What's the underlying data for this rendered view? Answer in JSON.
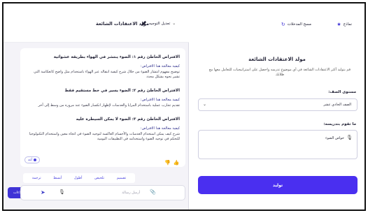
{
  "chat": {
    "header": {
      "title": "مولد الاعتقادات الشائعة",
      "edit_label": "تعديل التوجيه"
    },
    "message": {
      "blocks": [
        {
          "heading": "الافتراض الخاطئ رقم ١: الضوء ينتشر في الهواء بطريقة عشوائية",
          "question": "كيفية معالجة هذا الافتراض:",
          "answer": "توضيح مفهوم انتشار الضوء من خلال شرح كيفية انتقاله عبر الهواء باستخدام مثل واضح كانعكاسة التي تشير نحوه بشكل محدد"
        },
        {
          "heading": "الافتراض الخاطئ رقم ٢: الضوء يسير في خط مستقيم فقط",
          "question": "كيفية معالجة هذا الافتراض:",
          "answer": "تقديم تجارب عملية باستخدام المرايا والعدسات لإظهار انكسار الضوء عند مروره من وسط إلى آخر"
        },
        {
          "heading": "الافتراض الخاطئ رقم ٣: الضوء لا يمكن السيطرة عليه",
          "question": "كيفية معالجة هذا الافتراض:",
          "answer": "شرح كيف يمكن استخدام العدسات والأجسام العاكسة لتوجيه الضوء في اتجاه معين واستخدام التكنولوجيا للتحكم في توجيه الضوء واستخدامه في التطبيقات اليومية"
        }
      ]
    },
    "generate_chip": "أعد",
    "chips": [
      "تصميم",
      "تلخيص",
      "أطول",
      "أبسط",
      "ترجمة"
    ],
    "input_placeholder": "أرسل رسالة",
    "actions_label": "الإجراءات"
  },
  "tool": {
    "models_label": "نماذج",
    "clear_label": "مسح المدخلات",
    "title": "مولد الاعتقادات الشائعة",
    "description": "قم بتوليد أكثر الاعتقادات الشائعة في أي موضوع تدرسه واحصل على استراتيجيات للتعامل معها مع طلابك",
    "grade_label": "مستوى الصف:",
    "grade_value": "الصف الحادي عشر",
    "topic_label": "ما تقوم بتدريسه:",
    "topic_value": "خواص الضوء",
    "submit_label": "توليد"
  },
  "colors": {
    "accent": "#4a2ff0",
    "panel_bg": "#f4f3f8"
  }
}
